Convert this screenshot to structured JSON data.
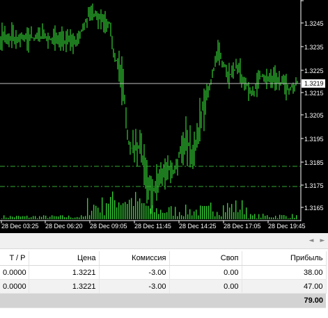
{
  "chart": {
    "price_axis_labels": [
      "1.3245",
      "1.3235",
      "1.3225",
      "1.3215",
      "1.3205",
      "1.3195",
      "1.3185",
      "1.3175",
      "1.3165"
    ],
    "current_price": "1.3219",
    "time_axis_labels": [
      "28 Dec 03:25",
      "28 Dec 06:20",
      "28 Dec 09:05",
      "28 Dec 11:45",
      "28 Dec 14:25",
      "28 Dec 17:05",
      "28 Dec 19:45"
    ],
    "colors": {
      "background": "#000000",
      "candles": "#33cc33",
      "volume": "#33cc33",
      "level_lines": "#33aa33",
      "price_line": "#c0c0c0",
      "grid_text": "#ffffff"
    }
  },
  "orders_table": {
    "columns": [
      "T / P",
      "Цена",
      "Комиссия",
      "Своп",
      "Прибыль"
    ],
    "rows": [
      [
        "0.0000",
        "1.3221",
        "-3.00",
        "0.00",
        "38.00"
      ],
      [
        "0.0000",
        "1.3221",
        "-3.00",
        "0.00",
        "47.00"
      ]
    ],
    "total_profit": "79.00"
  }
}
